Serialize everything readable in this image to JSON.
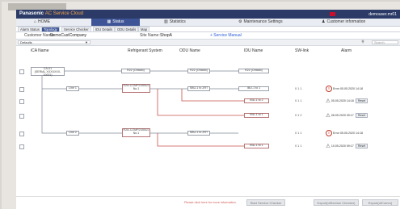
{
  "app": {
    "brand_a": "Panasonic",
    "brand_b": "AC Service Cloud",
    "user": "demouser.mr01"
  },
  "nav": [
    {
      "icon": "⌂",
      "label": "HOME"
    },
    {
      "icon": "▦",
      "label": "Status"
    },
    {
      "icon": "▥",
      "label": "Statistics"
    },
    {
      "icon": "⚙",
      "label": "Maintenance Settings"
    },
    {
      "icon": "♟",
      "label": "Customer information"
    }
  ],
  "subtabs": [
    "Alarm Status",
    "Topology",
    "Service Checker",
    "IDU Details",
    "ODU Details",
    "Map"
  ],
  "info": {
    "customer_label": "Customer Name:",
    "customer_value": "DemoCustCompany",
    "site_label": "Site Name:",
    "site_value": "ShopA",
    "service_manual": "+ Service Manual"
  },
  "filter": {
    "select_value": "Defaults",
    "search_placeholder": "Search"
  },
  "columns": {
    "ca": "iCA Name",
    "refrigerant": "Refrigerant System",
    "odu": "ODU Name",
    "idu": "IDU Name",
    "sw": "SW-link",
    "alarm": "Alarm"
  },
  "diagram": {
    "ca_box": [
      "CA-01",
      "(SERIAL XXXXXXX-10001)"
    ],
    "line_labels": [
      "Line 1",
      "Line 2"
    ],
    "refrigerant_boxes": [
      "R2A-COMP21B0U2",
      "R2A-COMP21B0U2"
    ],
    "refrigerant_sub": [
      "No.1",
      "No.1"
    ],
    "odu_boxes": [
      "R22 (Ontario)",
      "SBU-1 to ZRT",
      "SBU-1 to ZRT"
    ],
    "idu_boxes": [
      "R22 (Ontario)",
      "IBU-1 to 1",
      "IBU-1 to 2",
      "IBU-1 to 1"
    ],
    "sw_values": [
      "0 1 1",
      "0 1 1",
      "0 1 2",
      "0 1 1",
      "0 1 1"
    ],
    "alarms": [
      {
        "kind": "circle",
        "text": "Error 05.05.2020 14:18",
        "reset": ""
      },
      {
        "kind": "triangle",
        "text": "05.05.2020 14:18",
        "reset": "Reset"
      },
      {
        "kind": "triangle",
        "text": "08.05.2020 09:17",
        "reset": "Reset"
      },
      {
        "kind": "circle",
        "text": "Error 05.05.2020 14:18",
        "reset": ""
      },
      {
        "kind": "triangle",
        "text": "10.05.2020 09:17",
        "reset": "Reset"
      }
    ]
  },
  "footer": {
    "notice": "Please click here for more information.",
    "buttons": [
      "Start Service Checker",
      "Export(ofService Checker)",
      "Export(ofComm)"
    ]
  },
  "colors": {
    "nav": "#2b3a66",
    "active": "#3d5496",
    "accent": "#f5a64a",
    "error": "#c0392b",
    "link": "#2a5bd7",
    "red_line": "#c9514b"
  }
}
